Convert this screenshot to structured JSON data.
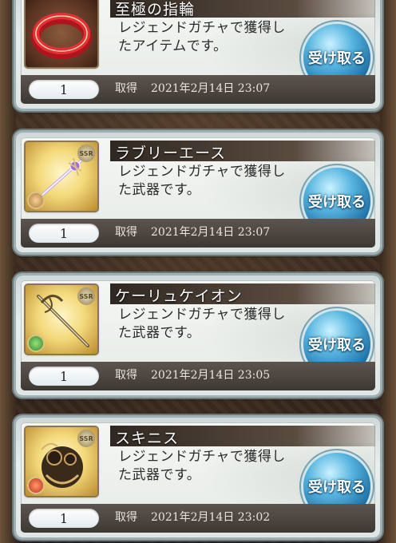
{
  "items": [
    {
      "name": "至極の指輪",
      "description": "レジェンドガチャで獲得し\nたアイテムです。",
      "button_label": "受け取る",
      "quantity": "1",
      "acquired_label": "取得",
      "acquired_date": "2021年2月14日 23:07",
      "thumb_type": "ring-icon",
      "element": ""
    },
    {
      "name": "ラブリーエース",
      "description": "レジェンドガチャで獲得し\nた武器です。",
      "button_label": "受け取る",
      "quantity": "1",
      "acquired_label": "取得",
      "acquired_date": "2021年2月14日 23:07",
      "thumb_type": "sword-icon",
      "badge": "SSR",
      "element": "light"
    },
    {
      "name": "ケーリュケイオン",
      "description": "レジェンドガチャで獲得し\nた武器です。",
      "button_label": "受け取る",
      "quantity": "1",
      "acquired_label": "取得",
      "acquired_date": "2021年2月14日 23:05",
      "thumb_type": "staff-icon",
      "badge": "SSR",
      "element": "wind"
    },
    {
      "name": "スキニス",
      "description": "レジェンドガチャで獲得し\nた武器です。",
      "button_label": "受け取る",
      "quantity": "1",
      "acquired_label": "取得",
      "acquired_date": "2021年2月14日 23:02",
      "thumb_type": "beast-icon",
      "badge": "SSR",
      "element": "fire"
    }
  ]
}
